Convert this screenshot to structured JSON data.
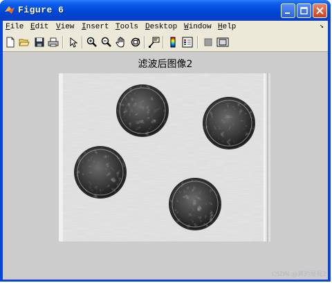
{
  "window": {
    "title": "Figure 6",
    "controls": {
      "minimize": "minimize-icon",
      "maximize": "maximize-icon",
      "close": "close-icon"
    }
  },
  "menubar": {
    "items": [
      {
        "accel": "F",
        "rest": "ile"
      },
      {
        "accel": "E",
        "rest": "dit"
      },
      {
        "accel": "V",
        "rest": "iew"
      },
      {
        "accel": "I",
        "rest": "nsert"
      },
      {
        "accel": "T",
        "rest": "ools"
      },
      {
        "accel": "D",
        "rest": "esktop"
      },
      {
        "accel": "W",
        "rest": "indow"
      },
      {
        "accel": "H",
        "rest": "elp"
      }
    ],
    "overflow_arrow": "↘"
  },
  "toolbar": {
    "icons": [
      "new-figure-icon",
      "open-file-icon",
      "save-icon",
      "print-icon",
      "edit-plot-arrow-icon",
      "zoom-in-icon",
      "zoom-out-icon",
      "pan-hand-icon",
      "rotate-3d-icon",
      "data-cursor-icon",
      "insert-colorbar-icon",
      "insert-legend-icon",
      "hide-plot-tools-icon",
      "show-plot-tools-icon"
    ]
  },
  "axes": {
    "title": "滤波后图像2"
  },
  "watermark": "CSDN @真的是我2"
}
